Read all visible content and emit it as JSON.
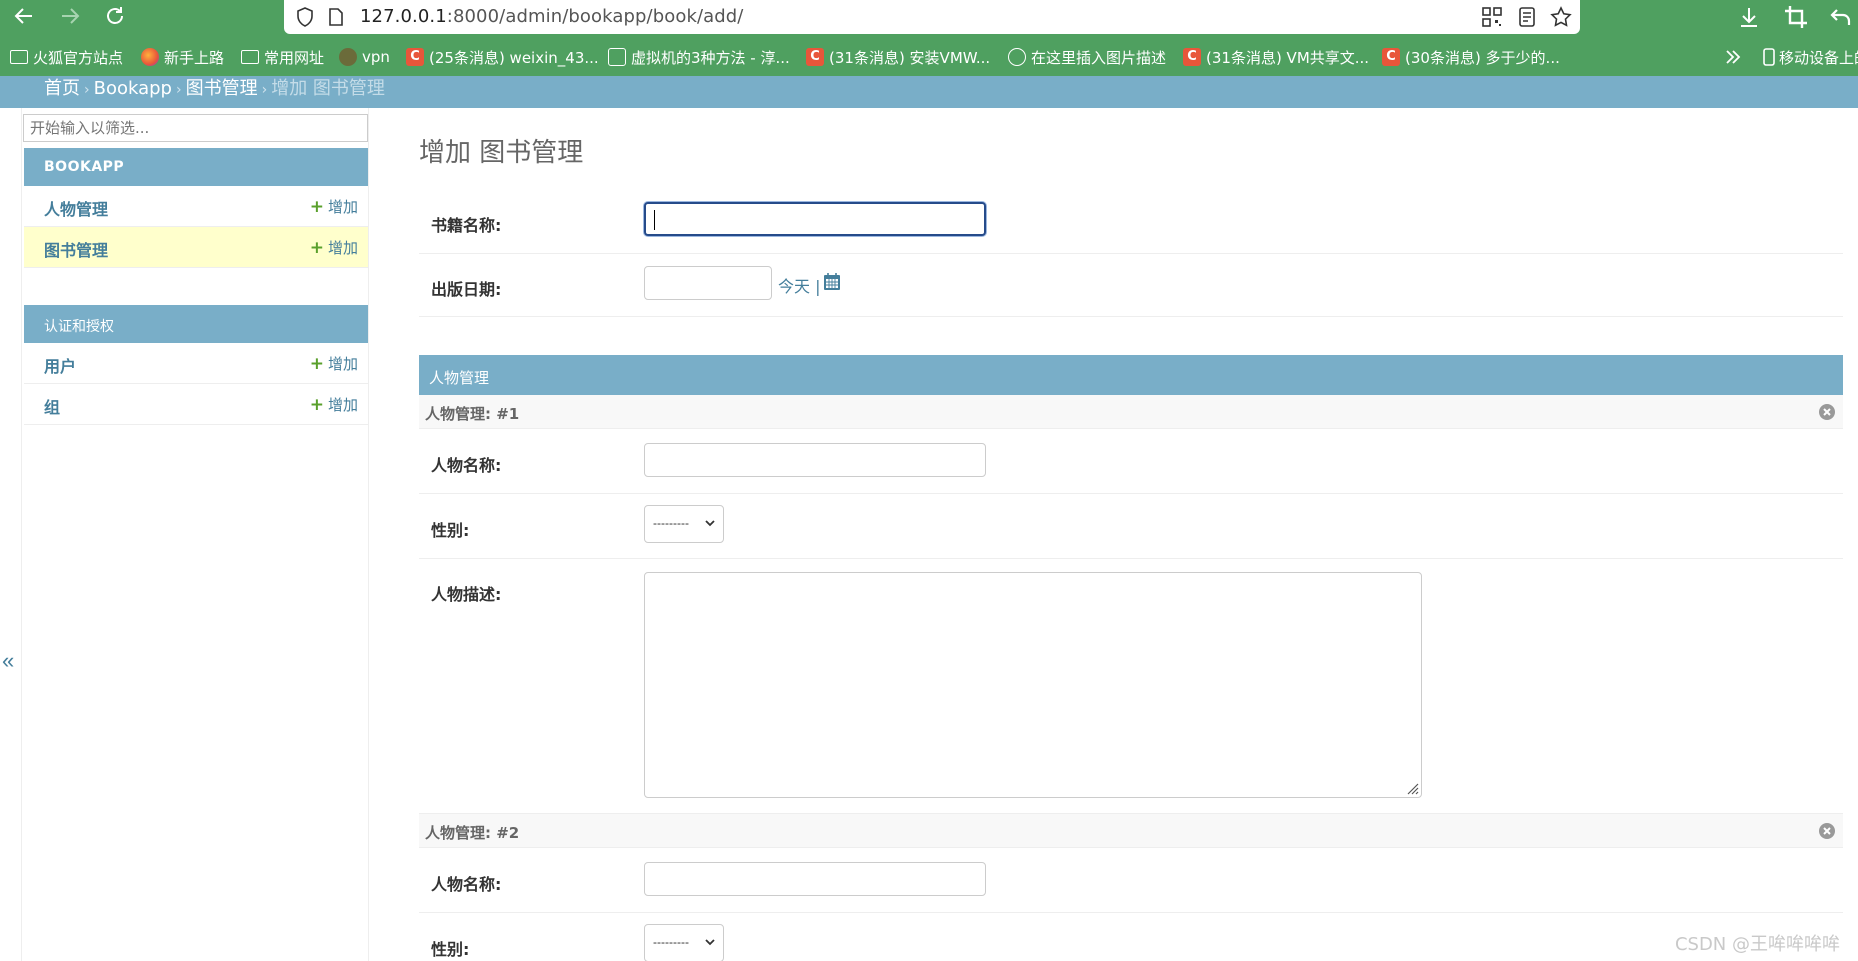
{
  "browser": {
    "url_host": "127.0.0.1",
    "url_port": ":8000",
    "url_path": "/admin/bookapp/book/add/",
    "bookmarks": [
      {
        "label": "火狐官方站点",
        "icon": "folder-icon"
      },
      {
        "label": "新手上路",
        "icon": "firefox-icon"
      },
      {
        "label": "常用网址",
        "icon": "folder-icon"
      },
      {
        "label": "vpn",
        "icon": "site-icon"
      },
      {
        "label": "(25条消息) weixin_43...",
        "icon": "csdn-icon"
      },
      {
        "label": "虚拟机的3种方法 - 淳...",
        "icon": "site-icon"
      },
      {
        "label": "(31条消息) 安装VMW...",
        "icon": "csdn-icon"
      },
      {
        "label": "在这里插入图片描述",
        "icon": "globe-icon"
      },
      {
        "label": "(31条消息) VM共享文...",
        "icon": "csdn-icon"
      },
      {
        "label": "(30条消息) 多于少的...",
        "icon": "csdn-icon"
      }
    ],
    "mobile_bookmarks": "移动设备上的"
  },
  "breadcrumbs": {
    "home": "首页",
    "app": "Bookapp",
    "model": "图书管理",
    "current": "增加 图书管理",
    "separator": "›"
  },
  "sidebar": {
    "filter_placeholder": "开始输入以筛选...",
    "toggle": "«",
    "modules": [
      {
        "caption": "BOOKAPP",
        "rows": [
          {
            "name": "人物管理",
            "add": "增加"
          },
          {
            "name": "图书管理",
            "add": "增加",
            "active": true
          }
        ]
      },
      {
        "caption": "认证和授权",
        "rows": [
          {
            "name": "用户",
            "add": "增加"
          },
          {
            "name": "组",
            "add": "增加"
          }
        ]
      }
    ]
  },
  "main": {
    "title": "增加 图书管理",
    "book_name_label": "书籍名称:",
    "pub_date_label": "出版日期:",
    "today_link": "今天",
    "pipe": "|",
    "inline": {
      "caption": "人物管理",
      "items": [
        {
          "title": "人物管理: #1",
          "name_label": "人物名称:",
          "gender_label": "性别:",
          "gender_value": "---------",
          "desc_label": "人物描述:"
        },
        {
          "title": "人物管理: #2",
          "name_label": "人物名称:",
          "gender_label": "性别:",
          "gender_value": "---------"
        }
      ]
    }
  },
  "watermark": "CSDN @王哞哞哞哞",
  "colors": {
    "browser_green": "#4fa060",
    "admin_blue": "#79aec8",
    "link_blue": "#447e9b",
    "active_row": "#ffffcc",
    "add_plus": "#5aa02c"
  }
}
